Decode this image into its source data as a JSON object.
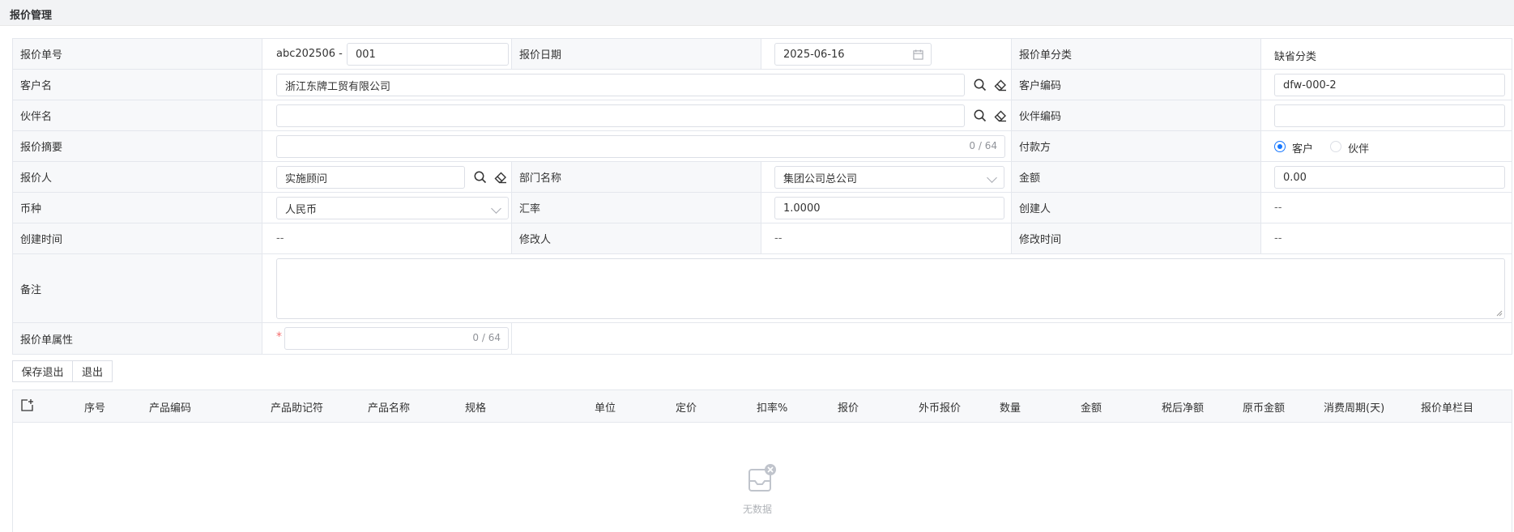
{
  "page": {
    "title": "报价管理"
  },
  "form": {
    "quote_no": {
      "label": "报价单号",
      "prefix": "abc202506 -",
      "value": "001"
    },
    "quote_date": {
      "label": "报价日期",
      "value": "2025-06-16"
    },
    "quote_category": {
      "label": "报价单分类",
      "value": "缺省分类"
    },
    "customer_name": {
      "label": "客户名",
      "value": "浙江东牌工贸有限公司"
    },
    "customer_code": {
      "label": "客户编码",
      "value": "dfw-000-2"
    },
    "partner_name": {
      "label": "伙伴名",
      "value": ""
    },
    "partner_code": {
      "label": "伙伴编码",
      "value": ""
    },
    "summary": {
      "label": "报价摘要",
      "value": "",
      "counter": "0 / 64"
    },
    "payer": {
      "label": "付款方",
      "options": [
        "客户",
        "伙伴"
      ],
      "selected": "客户"
    },
    "quoter": {
      "label": "报价人",
      "value": "实施顾问"
    },
    "department": {
      "label": "部门名称",
      "value": "集团公司总公司"
    },
    "amount": {
      "label": "金额",
      "value": "0.00"
    },
    "currency": {
      "label": "币种",
      "value": "人民币"
    },
    "exchange_rate": {
      "label": "汇率",
      "value": "1.0000"
    },
    "creator": {
      "label": "创建人",
      "value": "--"
    },
    "created_at": {
      "label": "创建时间",
      "value": "--"
    },
    "modifier": {
      "label": "修改人",
      "value": "--"
    },
    "modified_at": {
      "label": "修改时间",
      "value": "--"
    },
    "remark": {
      "label": "备注",
      "value": ""
    },
    "attribute": {
      "label": "报价单属性",
      "value": "",
      "counter": "0 / 64",
      "required_mark": "*"
    }
  },
  "actions": {
    "save_exit": "保存退出",
    "exit": "退出"
  },
  "table": {
    "columns": [
      "序号",
      "产品编码",
      "产品助记符",
      "产品名称",
      "规格",
      "单位",
      "定价",
      "扣率%",
      "报价",
      "外币报价",
      "数量",
      "金额",
      "税后净额",
      "原币金额",
      "消费周期(天)",
      "报价单栏目"
    ],
    "empty_text": "无数据"
  }
}
